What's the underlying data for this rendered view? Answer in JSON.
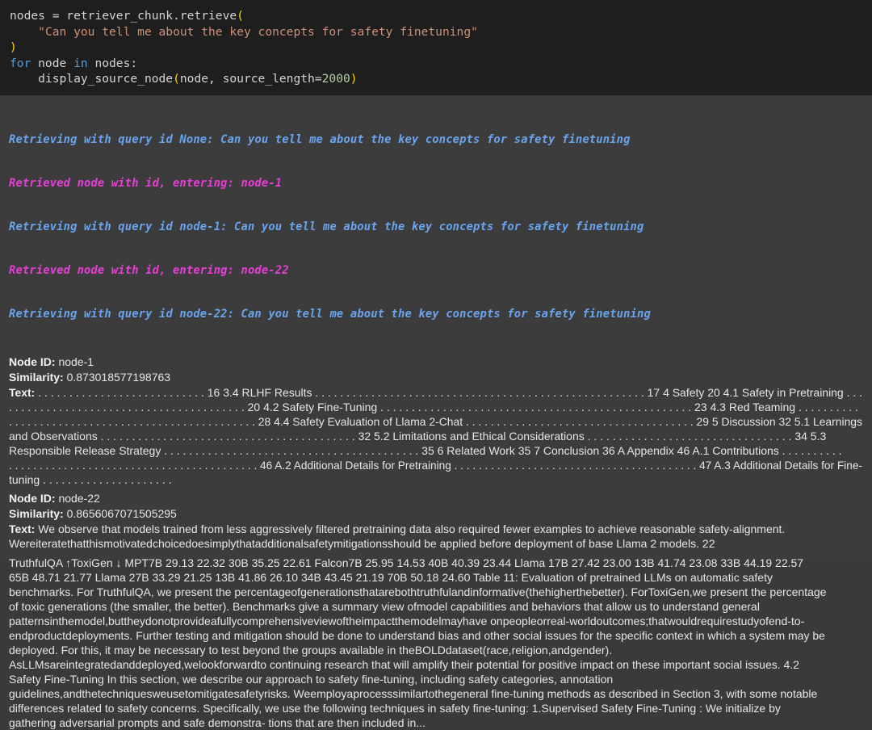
{
  "code": {
    "line1_pre": "nodes = retriever_chunk.retrieve",
    "line1_paren": "(",
    "line2_str": "\"Can you tell me about the key concepts for safety finetuning\"",
    "line3_paren": ")",
    "line4_kw_for": "for",
    "line4_var": " node ",
    "line4_kw_in": "in",
    "line4_rest": " nodes:",
    "line5_pre": "display_source_node",
    "line5_paren_open": "(",
    "line5_args": "node, source_length=",
    "line5_num": "2000",
    "line5_paren_close": ")"
  },
  "log_lines": [
    {
      "text": "Retrieving with query id None: Can you tell me about the key concepts for safety finetuning",
      "color": "#6aa4ee"
    },
    {
      "text": "Retrieved node with id, entering: node-1",
      "color": "#e63ed7"
    },
    {
      "text": "Retrieving with query id node-1: Can you tell me about the key concepts for safety finetuning",
      "color": "#6aa4ee"
    },
    {
      "text": "Retrieved node with id, entering: node-22",
      "color": "#e63ed7"
    },
    {
      "text": "Retrieving with query id node-22: Can you tell me about the key concepts for safety finetuning",
      "color": "#6aa4ee"
    }
  ],
  "labels": {
    "node_id": "Node ID:",
    "similarity": "Similarity:",
    "text": "Text:"
  },
  "nodes": [
    {
      "id": " node-1",
      "similarity": " 0.873018577198763",
      "text_lines": [
        " . . . . . . . . . . . . . . . . . . . . . . . . . . . 16 3.4 RLHF Results . . . . . . . . . . . . . . . . . . . . . . . . . . . . . . . . . . . . . . . . . . . . . . . . . . . . . 17 4 Safety 20 4.1 Safety in Pretraining . . .",
        ". . . . . . . . . . . . . . . . . . . . . . . . . . . . . . . . . . . . . . 20 4.2 Safety Fine-Tuning . . . . . . . . . . . . . . . . . . . . . . . . . . . . . . . . . . . . . . . . . . . . . . . . . . 23 4.3 Red Teaming . . . . . . . . . .",
        ". . . . . . . . . . . . . . . . . . . . . . . . . . . . . . . . . . . . . . . . 28 4.4 Safety Evaluation of Llama 2-Chat . . . . . . . . . . . . . . . . . . . . . . . . . . . . . . . . . . . . . 29 5 Discussion 32 5.1 Learnings",
        "and Observations . . . . . . . . . . . . . . . . . . . . . . . . . . . . . . . . . . . . . . . . . 32 5.2 Limitations and Ethical Considerations . . . . . . . . . . . . . . . . . . . . . . . . . . . . . . . . . 34 5.3",
        "Responsible Release Strategy . . . . . . . . . . . . . . . . . . . . . . . . . . . . . . . . . . . . . . . . . 35 6 Related Work 35 7 Conclusion 36 A Appendix 46 A.1 Contributions . . . . . . . . . .",
        ". . . . . . . . . . . . . . . . . . . . . . . . . . . . . . . . . . . . . . . . . 46 A.2 Additional Details for Pretraining . . . . . . . . . . . . . . . . . . . . . . . . . . . . . . . . . . . . . . . . 47 A.3 Additional Details for Fine-",
        "tuning . . . . . . . . . . . . . . . . . . . . ."
      ]
    },
    {
      "id": " node-22",
      "similarity": " 0.8656067071505295",
      "text_lines": [
        " We observe that models trained from less aggressively filtered pretraining data also required fewer examples to achieve reasonable safety-alignment.",
        "Wereiteratethatthismotivatedchoicedoesimplythatadditionalsafetymitigationsshould be applied before deployment of base Llama 2 models. 22",
        "",
        "TruthfulQA ↑ToxiGen ↓ MPT7B 29.13 22.32 30B 35.25 22.61 Falcon7B 25.95 14.53 40B 40.39 23.44 Llama 17B 27.42 23.00 13B 41.74 23.08 33B 44.19 22.57",
        "65B 48.71 21.77 Llama 27B 33.29 21.25 13B 41.86 26.10 34B 43.45 21.19 70B 50.18 24.60 Table 11: Evaluation of pretrained LLMs on automatic safety",
        "benchmarks. For TruthfulQA, we present the percentageofgenerationsthatarebothtruthfulandinformative(thehigherthebetter). ForToxiGen,we present the percentage",
        "of toxic generations (the smaller, the better). Benchmarks give a summary view ofmodel capabilities and behaviors that allow us to understand general",
        "patternsinthemodel,buttheydonotprovideafullycomprehensiveviewoftheimpactthemodelmayhave onpeopleorreal-worldoutcomes;thatwouldrequirestudyofend-to-",
        "endproductdeployments. Further testing and mitigation should be done to understand bias and other social issues for the specific context in which a system may be",
        "deployed. For this, it may be necessary to test beyond the groups available in theBOLDdataset(race,religion,andgender).",
        "AsLLMsareintegratedanddeployed,welookforwardto continuing research that will amplify their potential for positive impact on these important social issues. 4.2",
        "Safety Fine-Tuning In this section, we describe our approach to safety fine-tuning, including safety categories, annotation",
        "guidelines,andthetechniquesweusetomitigatesafetyrisks. Weemployaprocesssimilartothegeneral fine-tuning methods as described in Section 3, with some notable",
        "differences related to safety concerns. Specifically, we use the following techniques in safety fine-tuning: 1.Supervised Safety Fine-Tuning : We initialize by",
        "gathering adversarial prompts and safe demonstra- tions that are then included in..."
      ]
    }
  ]
}
